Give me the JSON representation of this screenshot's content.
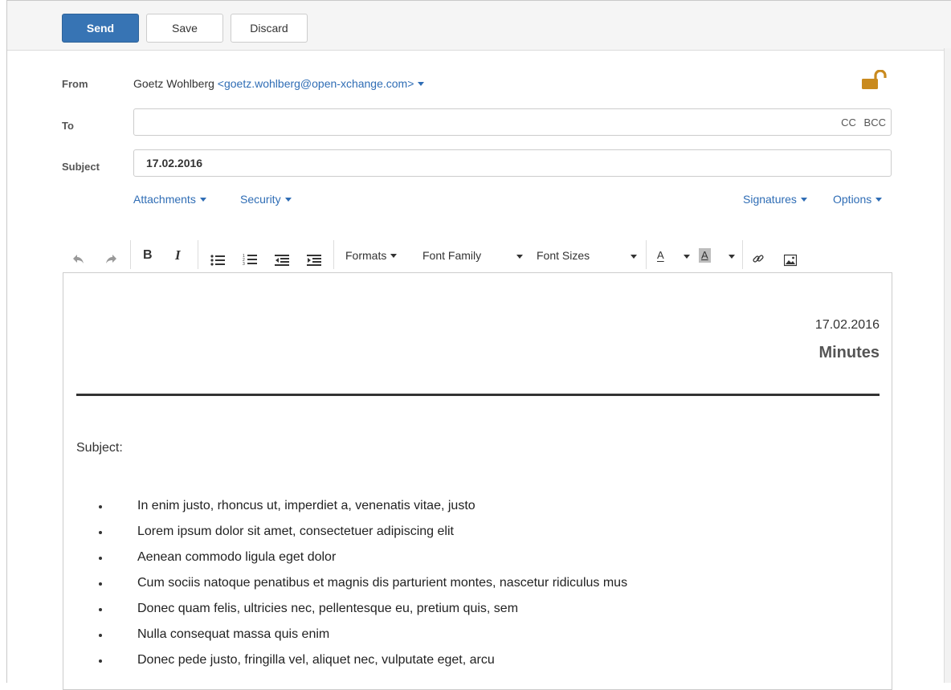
{
  "toolbar": {
    "send": "Send",
    "save": "Save",
    "discard": "Discard"
  },
  "header": {
    "from_label": "From",
    "from_name": "Goetz Wohlberg",
    "from_email": "<goetz.wohlberg@open-xchange.com>",
    "to_label": "To",
    "to_value": "",
    "cc": "CC",
    "bcc": "BCC",
    "subject_label": "Subject",
    "subject_value": "17.02.2016",
    "lock_icon": "unlocked-padlock-icon"
  },
  "links": {
    "attachments": "Attachments",
    "security": "Security",
    "signatures": "Signatures",
    "options": "Options"
  },
  "editor_toolbar": {
    "formats": "Formats",
    "font_family": "Font Family",
    "font_sizes": "Font Sizes",
    "bold": "B",
    "italic": "I",
    "text_color": "A",
    "bg_color": "A",
    "icons": [
      "undo-icon",
      "redo-icon",
      "bold-icon",
      "italic-icon",
      "bullet-list-icon",
      "numbered-list-icon",
      "outdent-icon",
      "indent-icon",
      "text-color-icon",
      "background-color-icon",
      "link-icon",
      "image-icon"
    ]
  },
  "body": {
    "date": "17.02.2016",
    "title": "Minutes",
    "subject_line": "Subject:",
    "bullets": [
      "In enim justo, rhoncus ut, imperdiet a, venenatis vitae, justo",
      "Lorem ipsum dolor sit amet, consectetuer adipiscing elit",
      "Aenean commodo ligula eget dolor",
      "Cum sociis natoque penatibus et magnis dis parturient montes, nascetur ridiculus mus",
      "Donec quam felis, ultricies nec, pellentesque eu, pretium quis, sem",
      "Nulla consequat massa quis enim",
      "Donec pede justo, fringilla vel, aliquet nec, vulputate eget, arcu"
    ]
  },
  "colors": {
    "accent": "#3774b4",
    "link": "#2f6db5",
    "lock": "#c98a1e"
  }
}
